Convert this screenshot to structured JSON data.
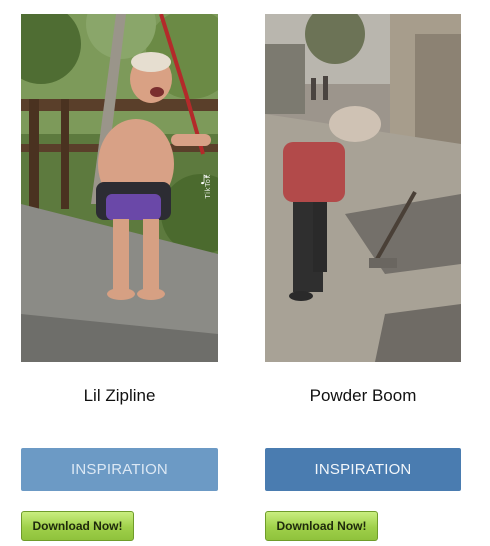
{
  "cards": [
    {
      "title": "Lil Zipline",
      "inspiration_label": "INSPIRATION",
      "download_label": "Download Now!",
      "watermark": "TikTok"
    },
    {
      "title": "Powder Boom",
      "inspiration_label": "INSPIRATION",
      "download_label": "Download Now!"
    }
  ],
  "colors": {
    "inspiration_button_faded": "#6c9ac5",
    "inspiration_button": "#4a7cb0",
    "download_button": "#9fd04a"
  }
}
